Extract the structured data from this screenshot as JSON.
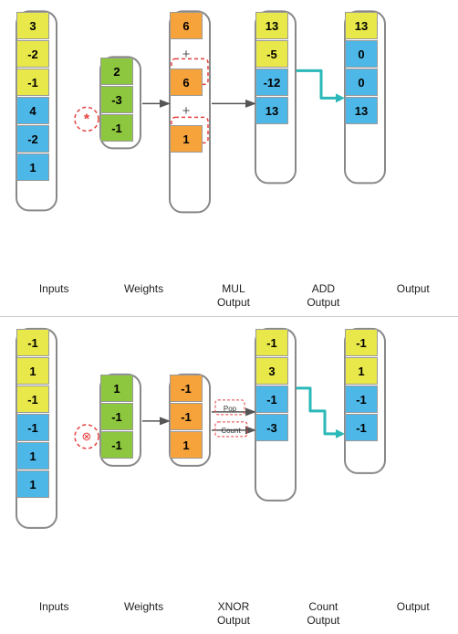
{
  "top": {
    "inputs": [
      3,
      -2,
      -1,
      4,
      -2,
      1
    ],
    "weights": [
      2,
      -3,
      -1
    ],
    "mul_output": [
      6,
      6,
      1
    ],
    "add_output": [
      13,
      -5,
      -12,
      13
    ],
    "output": [
      13,
      0,
      0,
      13
    ],
    "labels": [
      "Inputs",
      "Weights",
      "MUL\nOutput",
      "ADD\nOutput",
      "Output"
    ]
  },
  "bottom": {
    "inputs": [
      -1,
      1,
      -1,
      -1,
      1,
      1
    ],
    "weights": [
      1,
      -1,
      -1
    ],
    "xnor_output": [
      -1,
      -1,
      1
    ],
    "count_output": [
      -1,
      3,
      -1,
      -3
    ],
    "output": [
      -1,
      1,
      -1,
      -1
    ],
    "labels": [
      "Inputs",
      "Weights",
      "XNOR\nOutput",
      "Count\nOutput",
      "Output"
    ],
    "pop_label": "Pop",
    "count_label": "Count"
  }
}
